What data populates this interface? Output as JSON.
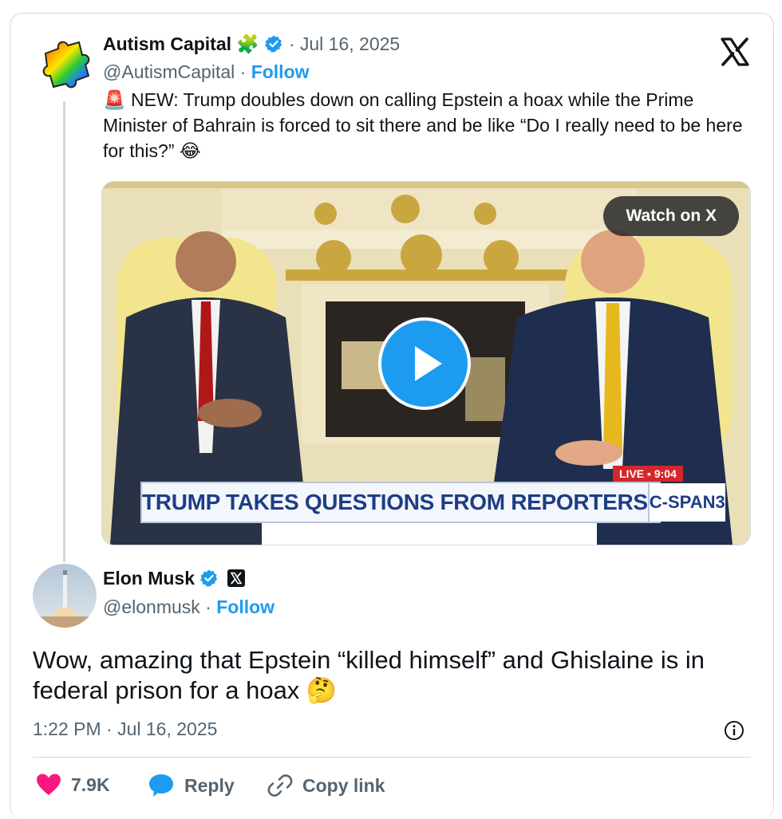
{
  "quoted_tweet": {
    "author_name": "Autism Capital",
    "name_emoji": "🧩",
    "date": "· Jul 16, 2025",
    "handle": "@AutismCapital",
    "follow_label": "Follow",
    "separator": "·",
    "alert_emoji": "🚨",
    "text": "NEW: Trump doubles down on calling Epstein a hoax while the Prime Minister of Bahrain is forced to sit there and be like “Do I really need to be here for this?” 😂",
    "video": {
      "watch_label": "Watch on X",
      "banner_text": "TRUMP TAKES QUESTIONS FROM REPORTERS",
      "network_logo": "C-SPAN3",
      "live_label": "LIVE ▪ 9:04"
    }
  },
  "main_tweet": {
    "author_name": "Elon Musk",
    "handle": "@elonmusk",
    "follow_label": "Follow",
    "separator": "·",
    "text": "Wow, amazing that Epstein “killed himself” and Ghislaine is in federal prison for a hoax 🤔",
    "timestamp": "1:22 PM · Jul 16, 2025"
  },
  "actions": {
    "likes_count": "7.9K",
    "reply_label": "Reply",
    "copy_link_label": "Copy link"
  },
  "colors": {
    "accent": "#1d9bf0",
    "like": "#f91880",
    "text_secondary": "#536471",
    "border": "#cfd9de"
  },
  "icons": [
    "x-logo-icon",
    "verified-badge-icon",
    "puzzle-piece-icon",
    "play-icon",
    "info-icon",
    "heart-icon",
    "reply-bubble-icon",
    "link-icon"
  ]
}
